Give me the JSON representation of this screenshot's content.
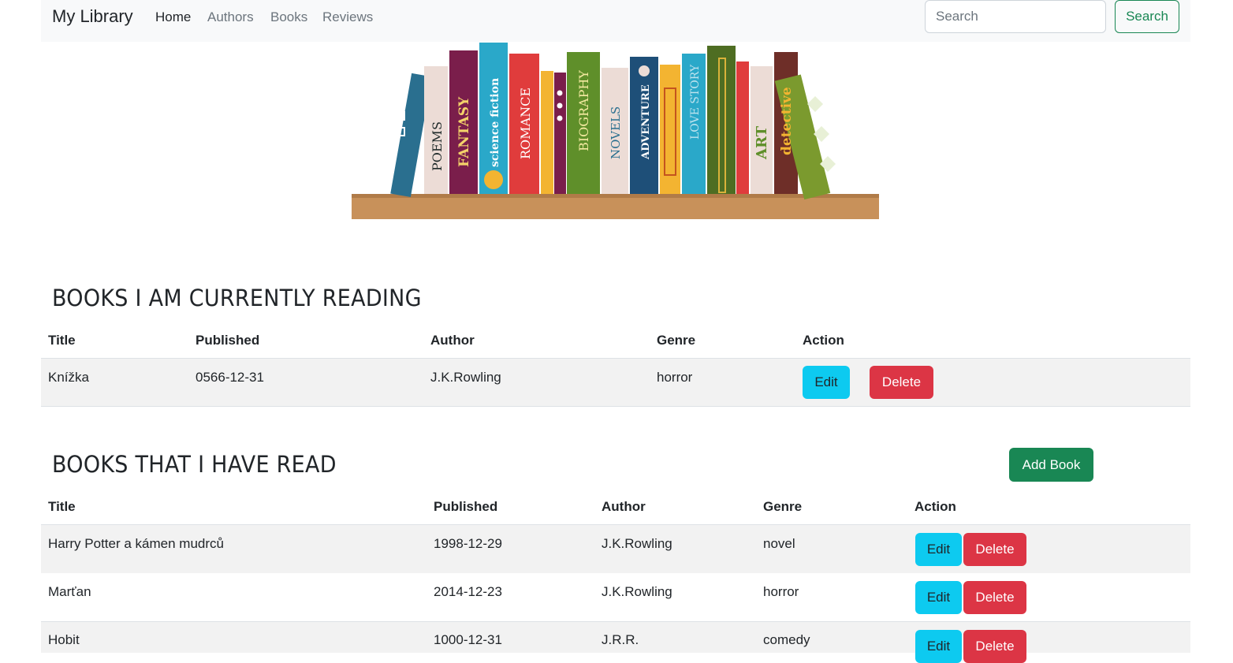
{
  "navbar": {
    "brand": "My Library",
    "links": [
      "Home",
      "Authors",
      "Books",
      "Reviews"
    ],
    "search_placeholder": "Search",
    "search_button": "Search"
  },
  "banner": {
    "spines": [
      "POEMS",
      "FANTASY",
      "science fiction",
      "ROMANCE",
      "BIOGRAPHY",
      "NOVELS",
      "ADVENTURE",
      "LOVE STORY",
      "ART",
      "detective"
    ]
  },
  "current": {
    "title": "BOOKS I AM CURRENTLY READING",
    "headers": [
      "Title",
      "Published",
      "Author",
      "Genre",
      "Action"
    ],
    "rows": [
      {
        "title": "Knížka",
        "published": "0566-12-31",
        "author": "J.K.Rowling",
        "genre": "horror"
      }
    ],
    "edit_label": "Edit",
    "delete_label": "Delete"
  },
  "read": {
    "title": "BOOKS THAT I HAVE READ",
    "add_button": "Add Book",
    "headers": [
      "Title",
      "Published",
      "Author",
      "Genre",
      "Action"
    ],
    "rows": [
      {
        "title": "Harry Potter a kámen mudrců",
        "published": "1998-12-29",
        "author": "J.K.Rowling",
        "genre": "novel"
      },
      {
        "title": "Marťan",
        "published": "2014-12-23",
        "author": "J.K.Rowling",
        "genre": "horror"
      },
      {
        "title": "Hobit",
        "published": "1000-12-31",
        "author": "J.R.R.",
        "genre": "comedy"
      }
    ],
    "edit_label": "Edit",
    "delete_label": "Delete"
  },
  "colors": {
    "info": "#0dcaf0",
    "danger": "#dc3545",
    "success": "#198754",
    "navbar_bg": "#f8f9fa"
  }
}
